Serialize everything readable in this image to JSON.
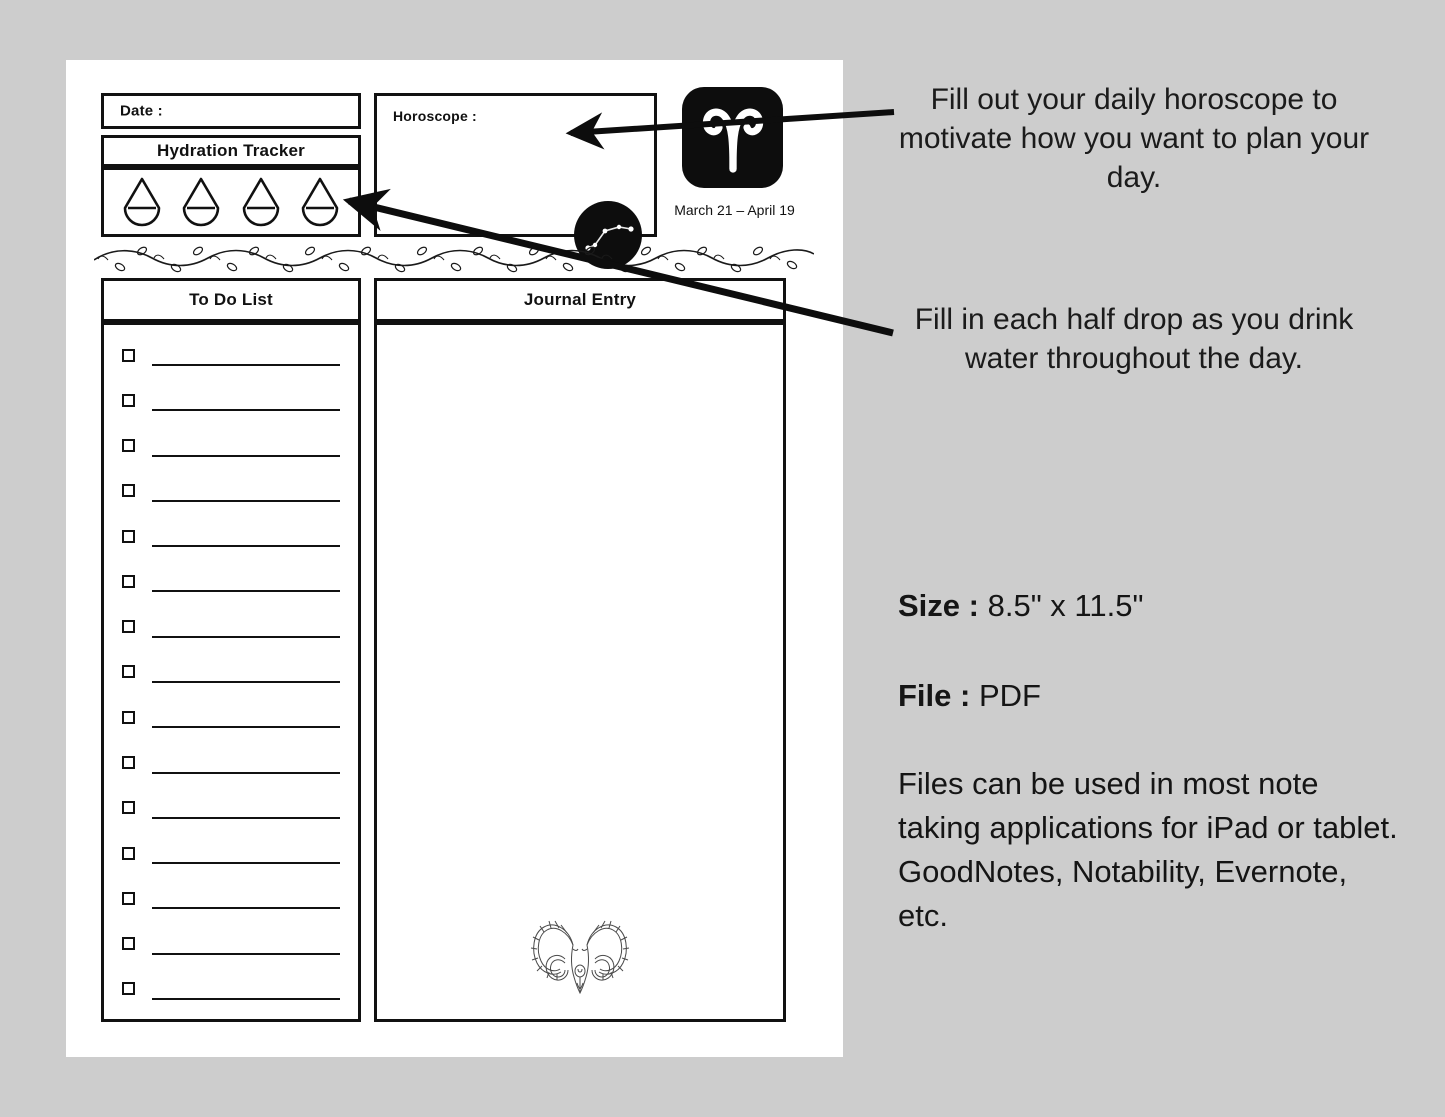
{
  "background_color": "#cdcdcd",
  "ink_color": "#111111",
  "planner": {
    "date_field": {
      "label": "Date :"
    },
    "hydration": {
      "title": "Hydration Tracker",
      "drop_count": 4,
      "drop_icon": "water-drop-icon"
    },
    "horoscope": {
      "label": "Horoscope :",
      "constellation_icon": "aries-constellation-icon",
      "zodiac_glyph": "aries-glyph-icon",
      "zodiac_dates": "March 21 – April 19"
    },
    "divider_icon": "vine-leaf-divider-icon",
    "todo": {
      "title": "To Do List",
      "row_count": 15,
      "checkbox_icon": "checkbox-icon"
    },
    "journal": {
      "title": "Journal Entry",
      "decoration_icon": "ram-head-icon"
    }
  },
  "callouts": [
    {
      "id": "horoscope-callout",
      "text": "Fill out your daily horoscope to motivate how you want to plan your day.",
      "arrow_icon": "arrow-left-icon"
    },
    {
      "id": "hydration-callout",
      "text": "Fill in each half drop as you drink water throughout the day.",
      "arrow_icon": "arrow-left-icon"
    }
  ],
  "specs": {
    "size_label": "Size :",
    "size_value": "8.5\" x 11.5\"",
    "file_label": "File :",
    "file_value": "PDF",
    "note": "Files can be used in most note taking applications for iPad or tablet. GoodNotes, Notability, Evernote, etc."
  }
}
